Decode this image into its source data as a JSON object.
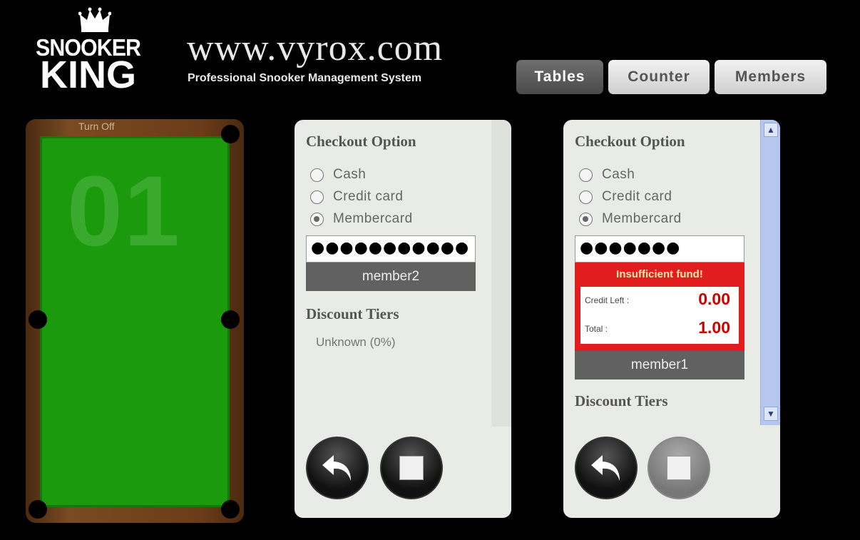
{
  "logo": {
    "top_word": "SNOOKER",
    "bottom_word": "KING"
  },
  "header": {
    "site": "www.vyrox.com",
    "subtitle": "Professional Snooker Management System"
  },
  "nav": {
    "tables": "Tables",
    "counter": "Counter",
    "members": "Members",
    "active": "Tables"
  },
  "table": {
    "turn_off": "Turn Off",
    "number": "01",
    "felt_color": "#1a9a0c"
  },
  "panel1": {
    "title": "Checkout Option",
    "options": [
      "Cash",
      "Credit card",
      "Membercard"
    ],
    "selected": "Membercard",
    "password": "●●●●●●●●●●●",
    "member": "member2",
    "discount_title": "Discount Tiers",
    "discount_value": "Unknown (0%)"
  },
  "panel2": {
    "title": "Checkout Option",
    "options": [
      "Cash",
      "Credit card",
      "Membercard"
    ],
    "selected": "Membercard",
    "password": "●●●●●●●",
    "error_title": "Insufficient fund!",
    "credit_left_label": "Credit Left :",
    "credit_left_value": "0.00",
    "total_label": "Total :",
    "total_value": "1.00",
    "member": "member1",
    "discount_title": "Discount Tiers"
  },
  "colors": {
    "error_red": "#e11d1d",
    "member_bar": "#616161",
    "scrollbar_blue": "#b6c7ef"
  },
  "icons": {
    "undo": "undo-arrow-icon",
    "stop": "stop-icon"
  }
}
